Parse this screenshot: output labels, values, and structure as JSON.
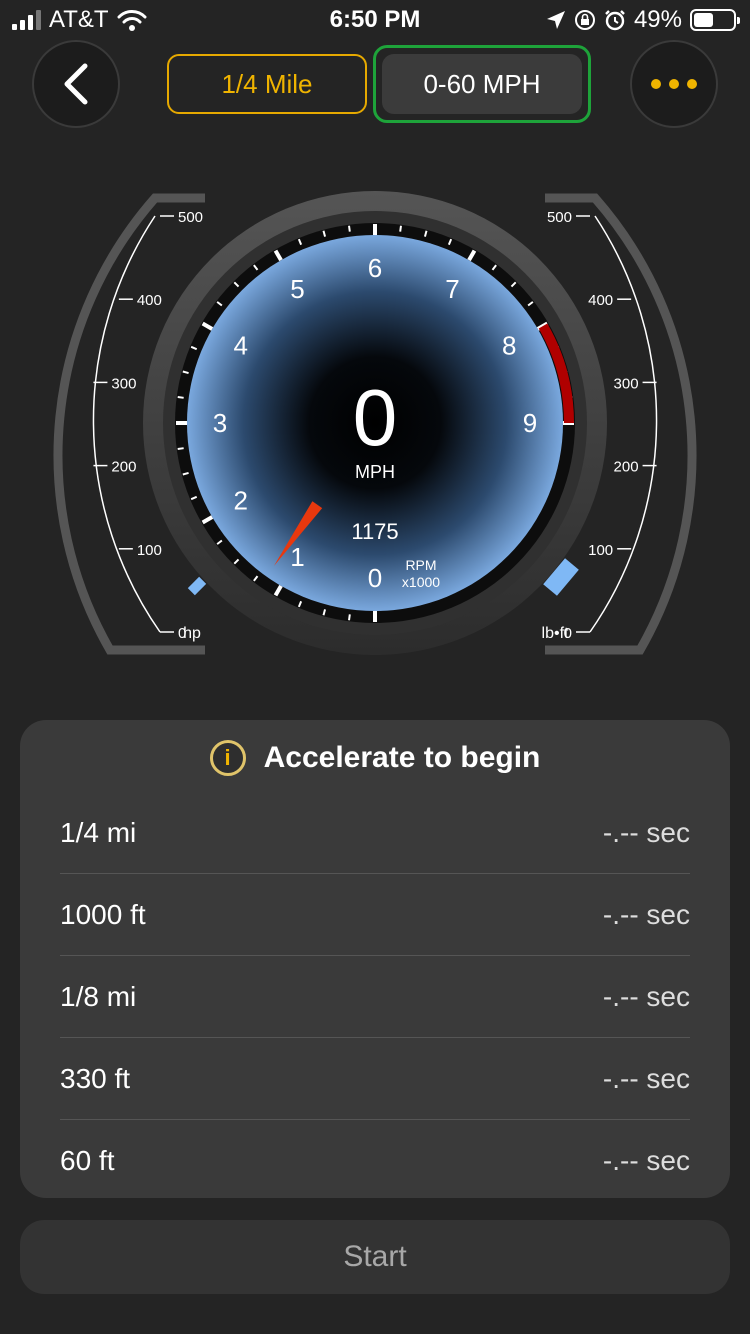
{
  "status_bar": {
    "carrier": "AT&T",
    "time": "6:50 PM",
    "battery_percent": "49%",
    "battery_level": 0.49
  },
  "header": {
    "tabs": [
      {
        "label": "1/4 Mile",
        "active": false
      },
      {
        "label": "0-60 MPH",
        "active": true
      }
    ],
    "back_icon": "chevron-left-icon",
    "more_icon": "ellipsis-icon"
  },
  "gauge": {
    "speed": "0",
    "speed_unit": "MPH",
    "rpm": "1175",
    "rpm_label": "RPM",
    "rpm_scale": "x1000",
    "rpm_ticks": [
      "0",
      "1",
      "2",
      "3",
      "4",
      "5",
      "6",
      "7",
      "8",
      "9"
    ],
    "rpm_value": 1.175,
    "redline_start": 8,
    "hp_scale": [
      "0",
      "100",
      "200",
      "300",
      "400",
      "500"
    ],
    "hp_unit": "hp",
    "torque_scale": [
      "0",
      "100",
      "200",
      "300",
      "400",
      "500"
    ],
    "torque_unit": "lb•ft",
    "colors": {
      "dial": "#6f9fd8",
      "needle": "#e8380e",
      "redline": "#b00000",
      "bar": "#7fb8f5"
    }
  },
  "results": {
    "title": "Accelerate to begin",
    "rows": [
      {
        "label": "1/4 mi",
        "value": "-.-- sec"
      },
      {
        "label": "1000 ft",
        "value": "-.-- sec"
      },
      {
        "label": "1/8 mi",
        "value": "-.-- sec"
      },
      {
        "label": "330 ft",
        "value": "-.-- sec"
      },
      {
        "label": "60 ft",
        "value": "-.-- sec"
      }
    ]
  },
  "start_label": "Start"
}
